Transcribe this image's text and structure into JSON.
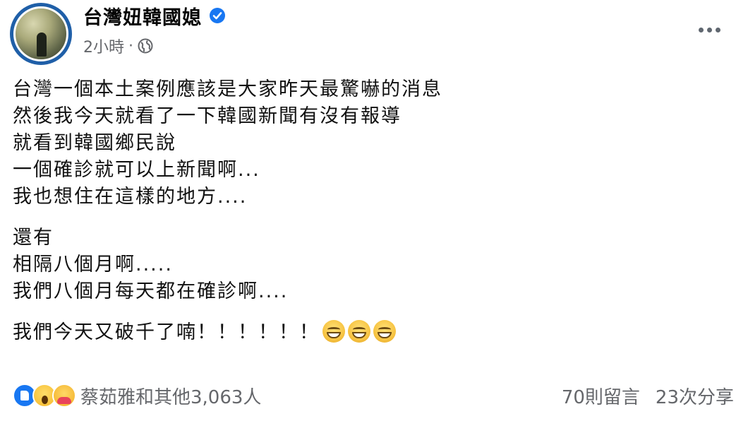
{
  "header": {
    "page_name": "台灣妞韓國媳",
    "time": "2小時",
    "separator": "·"
  },
  "icons": {
    "avatar": "profile-avatar",
    "verified": "verified-badge-icon",
    "audience": "globe-icon",
    "more": "more-options-icon",
    "accent": "#1877f2"
  },
  "post": {
    "lines_p1": [
      "台灣一個本土案例應該是大家昨天最驚嚇的消息",
      "然後我今天就看了一下韓國新聞有沒有報導",
      "就看到韓國鄉民說",
      "一個確診就可以上新聞啊...",
      "我也想住在這樣的地方...."
    ],
    "lines_p2": [
      "還有",
      "相隔八個月啊.....",
      "我們八個月每天都在確診啊...."
    ],
    "lines_p3": [
      "我們今天又破千了喃！！！！！！"
    ],
    "emojis": [
      "grinning-face",
      "grinning-face",
      "grinning-face"
    ]
  },
  "footer": {
    "reactions": [
      "like",
      "wow",
      "care"
    ],
    "reactors": "蔡茹雅和其他3,063人",
    "comments": "70則留言",
    "shares": "23次分享"
  }
}
